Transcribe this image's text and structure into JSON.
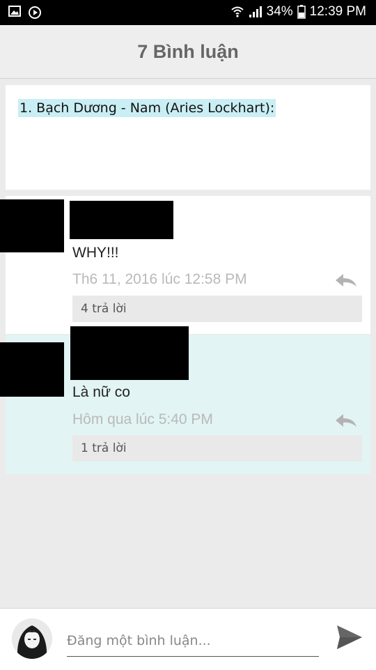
{
  "status_bar": {
    "battery": "34%",
    "time": "12:39 PM"
  },
  "header": {
    "title": "7 Bình luận"
  },
  "post": {
    "title": "1. Bạch Dương - Nam (Aries Lockhart):"
  },
  "comments": [
    {
      "text": "WHY!!!",
      "time": "Th6 11, 2016 lúc 12:58 PM",
      "replies": "4 trả lời",
      "highlighted": false
    },
    {
      "text": "Là nữ co",
      "time": "Hôm qua lúc 5:40 PM",
      "replies": "1 trả lời",
      "highlighted": true
    }
  ],
  "composer": {
    "placeholder": "Đăng một bình luận..."
  },
  "colors": {
    "highlight_bg": "#e2f4f4",
    "post_title_highlight": "#c9eef3",
    "header_title": "#666666",
    "timestamp": "#b9b9b9"
  }
}
